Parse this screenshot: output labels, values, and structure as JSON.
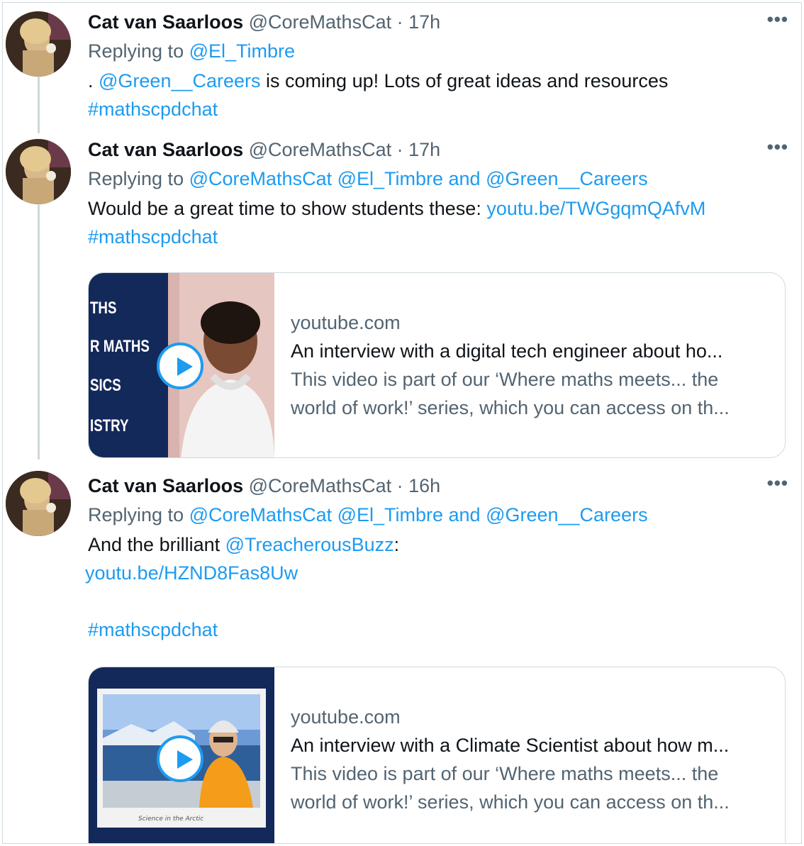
{
  "tweets": [
    {
      "name": "Cat van Saarloos",
      "handle": "@CoreMathsCat",
      "separator": "·",
      "time": "17h",
      "replying_prefix": "Replying to",
      "replying_to": "@El_Timbre",
      "text_prefix": ". ",
      "mention": "@Green__Careers",
      "text_body": " is coming up! Lots of great ideas and resources",
      "hashtag": "#mathscpdchat"
    },
    {
      "name": "Cat van Saarloos",
      "handle": "@CoreMathsCat",
      "separator": "·",
      "time": "17h",
      "replying_prefix": "Replying to",
      "replying_to": "@CoreMathsCat @El_Timbre and @Green__Careers",
      "text_body": "Would be a great time to show students these: ",
      "link": "youtu.be/TWGgqmQAfvM",
      "hashtag": "#mathscpdchat",
      "card": {
        "domain": "youtube.com",
        "title": "An interview with a digital tech engineer about ho...",
        "desc_line1": "This video is part of our ‘Where maths meets... the",
        "desc_line2": "world of work!’ series, which you can access on th...",
        "media_words": [
          "THS",
          "R MATHS",
          "SICS",
          "ISTRY"
        ]
      }
    },
    {
      "name": "Cat van Saarloos",
      "handle": "@CoreMathsCat",
      "separator": "·",
      "time": "16h",
      "replying_prefix": "Replying to",
      "replying_to": "@CoreMathsCat @El_Timbre and @Green__Careers",
      "text_body": "And the brilliant ",
      "mention": "@TreacherousBuzz",
      "text_suffix": ":",
      "link": "youtu.be/HZND8Fas8Uw",
      "hashtag": "#mathscpdchat",
      "card": {
        "domain": "youtube.com",
        "title": "An interview with a Climate Scientist about how m...",
        "desc_line1": "This video is part of our ‘Where maths meets... the",
        "desc_line2": "world of work!’ series, which you can access on th..."
      }
    }
  ],
  "more_icon": "more-horizontal-icon",
  "more_glyph": "•••",
  "colors": {
    "link": "#1d9bf0",
    "secondary": "#536471",
    "border": "#cfd9de",
    "card_navy": "#13295a"
  }
}
